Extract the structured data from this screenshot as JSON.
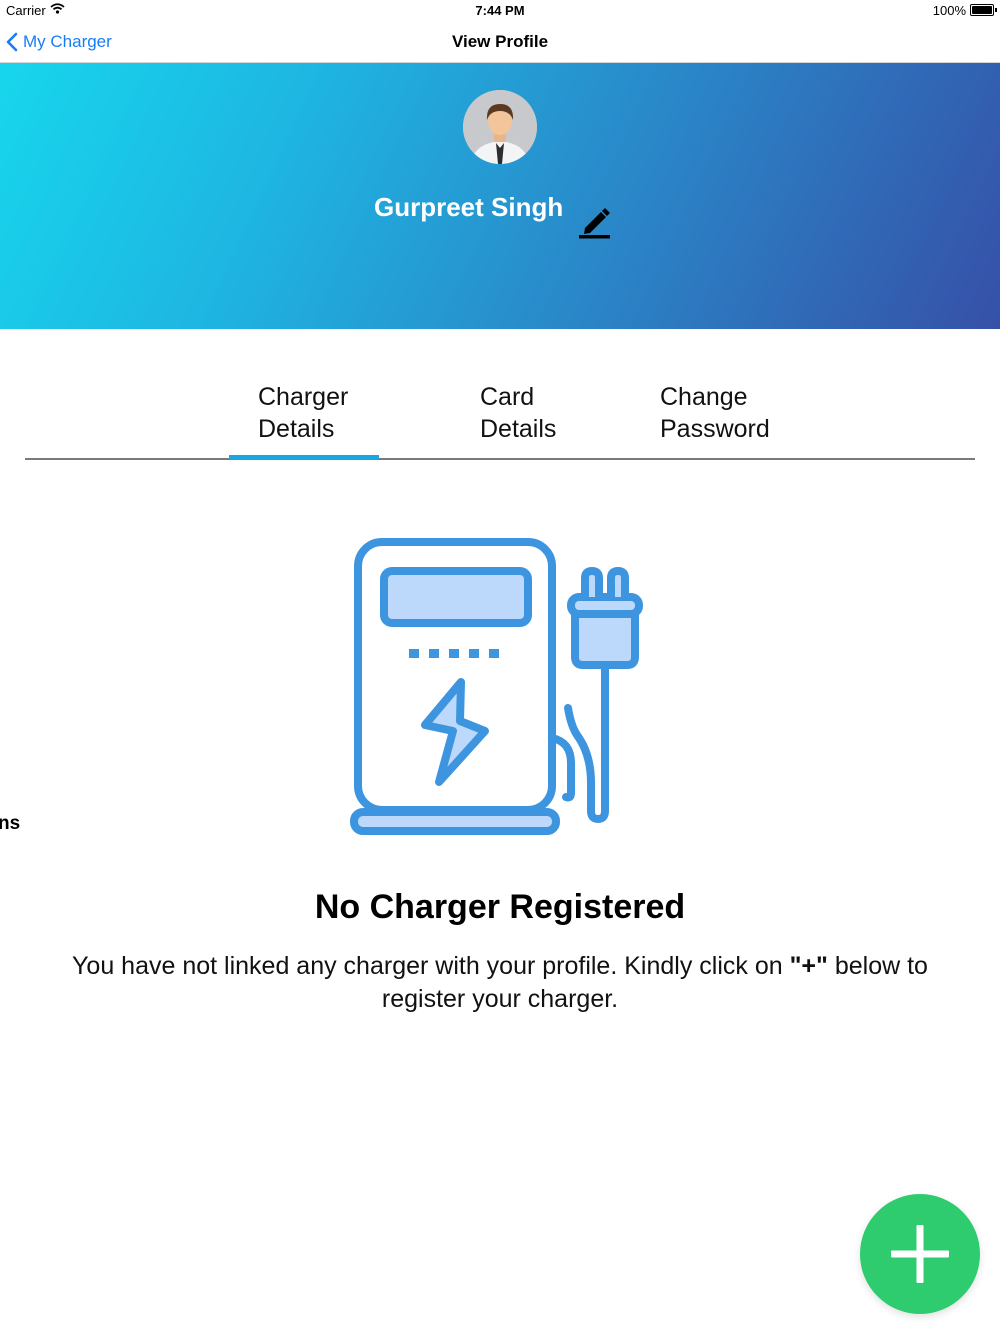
{
  "status_bar": {
    "carrier": "Carrier",
    "time": "7:44 PM",
    "battery": "100%"
  },
  "nav": {
    "back_label": "My Charger",
    "title": "View Profile"
  },
  "profile": {
    "name": "Gurpreet Singh"
  },
  "tabs": [
    {
      "line1": "Charger",
      "line2": "Details",
      "selected": true
    },
    {
      "line1": "Card",
      "line2": "Details",
      "selected": false
    },
    {
      "line1": "Change",
      "line2": "Password",
      "selected": false
    }
  ],
  "empty_state": {
    "title": "No Charger Registered",
    "message_before": "You have not linked any charger with your profile. Kindly click on ",
    "message_emphasis": "\"+\"",
    "message_after": " below to register your charger."
  },
  "side_fragment": "ns",
  "colors": {
    "accent": "#1aa6e0",
    "back_link": "#1a7cf5",
    "fab": "#2ecc6e",
    "illustration_stroke": "#3d95e0",
    "illustration_fill": "#bcd9fb"
  },
  "icons": [
    "wifi-icon",
    "battery-icon",
    "chevron-left-icon",
    "avatar",
    "pencil-icon",
    "ev-charger-icon",
    "plus-icon"
  ]
}
